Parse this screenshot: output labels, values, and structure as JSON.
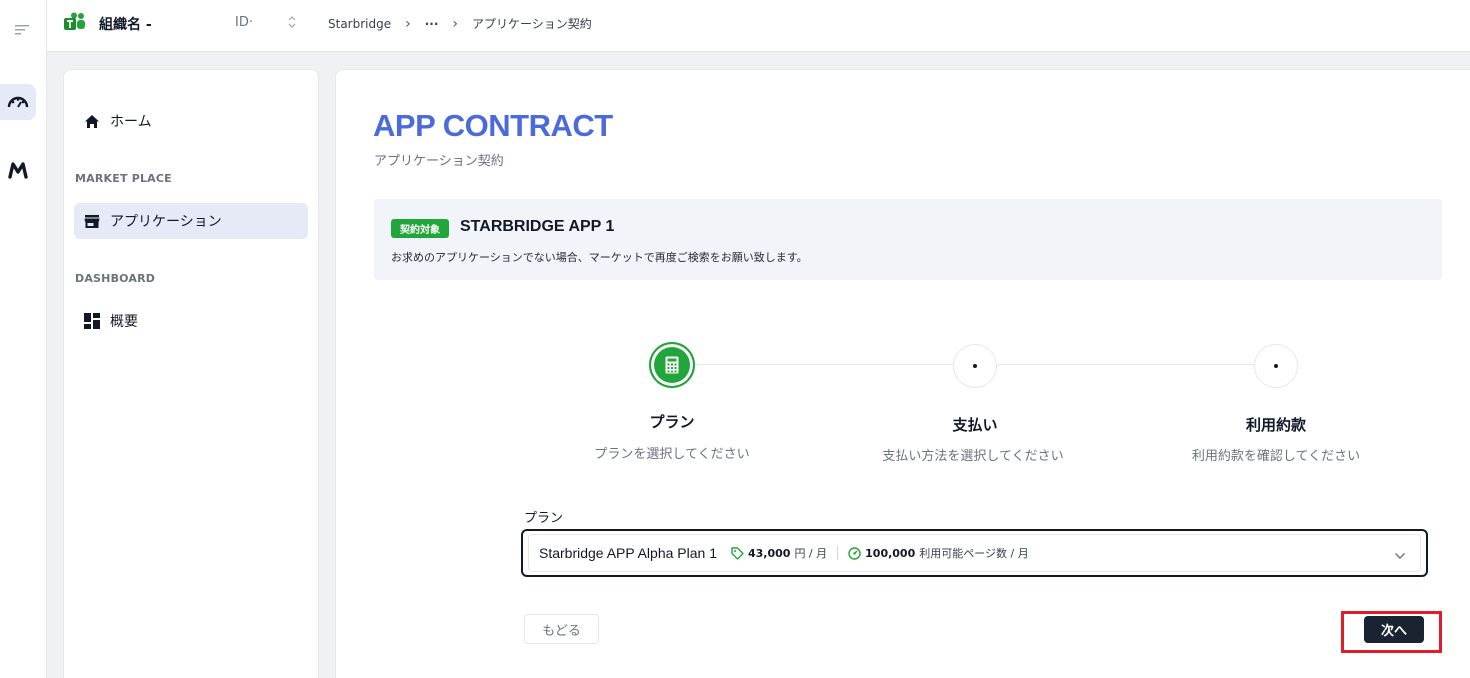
{
  "topbar": {
    "org_name": "組織名 -",
    "org_id_label": "ID·",
    "breadcrumbs": [
      "Starbridge",
      "···",
      "アプリケーション契約"
    ]
  },
  "sidebar": {
    "home": "ホーム",
    "section_market": "MARKET PLACE",
    "applications": "アプリケーション",
    "section_dashboard": "DASHBOARD",
    "overview": "概要"
  },
  "page": {
    "title": "APP CONTRACT",
    "subtitle": "アプリケーション契約"
  },
  "target": {
    "badge": "契約対象",
    "app_name": "STARBRIDGE APP 1",
    "note": "お求めのアプリケーションでない場合、マーケットで再度ご検索をお願い致します。"
  },
  "steps": [
    {
      "title": "プラン",
      "desc": "プランを選択してください",
      "state": "active"
    },
    {
      "title": "支払い",
      "desc": "支払い方法を選択してください",
      "state": "inactive"
    },
    {
      "title": "利用約款",
      "desc": "利用約款を確認してください",
      "state": "inactive"
    }
  ],
  "plan": {
    "label": "プラン",
    "name": "Starbridge APP Alpha Plan 1",
    "price_value": "43,000",
    "price_unit": "円 / 月",
    "pages_value": "100,000",
    "pages_unit": "利用可能ページ数 / 月"
  },
  "actions": {
    "back": "もどる",
    "next": "次へ"
  },
  "colors": {
    "accent": "#4b6bdc",
    "success": "#22a53a",
    "next_button": "#1a2332",
    "highlight": "#e11d2a"
  }
}
